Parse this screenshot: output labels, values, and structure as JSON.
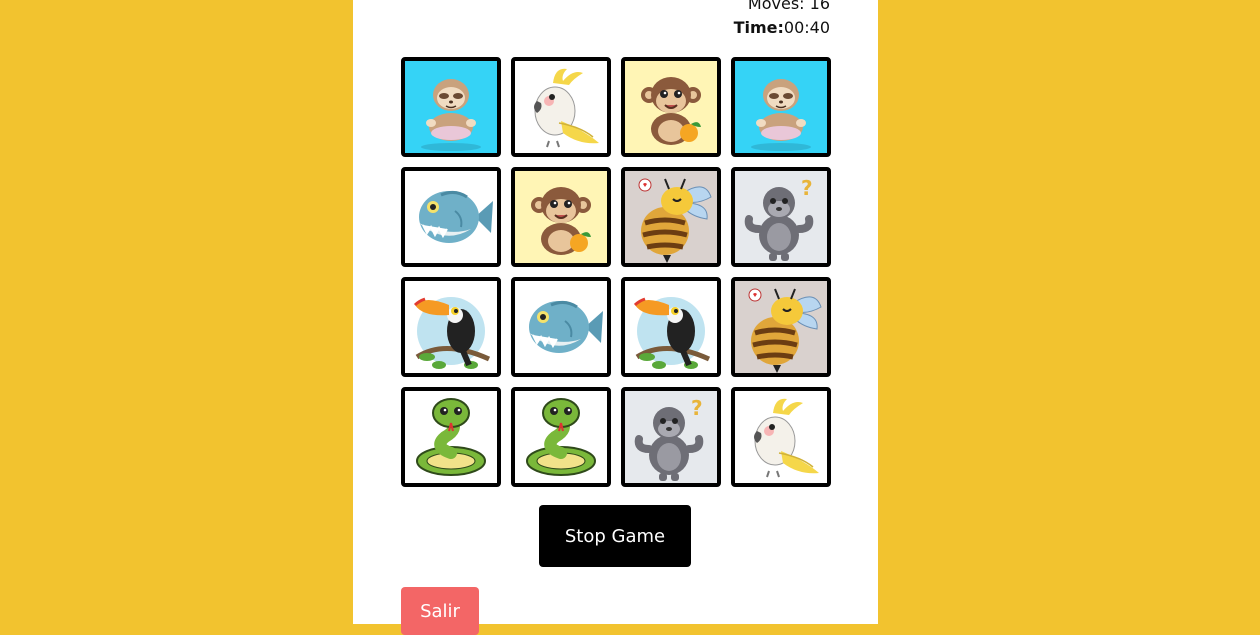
{
  "stats": {
    "moves_label": "Moves:",
    "moves_value": "16",
    "time_label": "Time:",
    "time_value": "00:40"
  },
  "cards": [
    {
      "animal": "sloth",
      "bg": "#35D3F6",
      "state": "face-up"
    },
    {
      "animal": "cockatoo",
      "bg": "#FFFFFF",
      "state": "face-up"
    },
    {
      "animal": "monkey",
      "bg": "#FFF5B5",
      "state": "face-up"
    },
    {
      "animal": "sloth",
      "bg": "#35D3F6",
      "state": "face-up"
    },
    {
      "animal": "piranha",
      "bg": "#FFFFFF",
      "state": "face-up"
    },
    {
      "animal": "monkey",
      "bg": "#FFF5B5",
      "state": "face-up"
    },
    {
      "animal": "bee",
      "bg": "#D9D1CE",
      "state": "face-up"
    },
    {
      "animal": "gorilla",
      "bg": "#E6E9ED",
      "state": "face-up"
    },
    {
      "animal": "toucan",
      "bg": "#FFFFFF",
      "state": "face-up"
    },
    {
      "animal": "piranha",
      "bg": "#FFFFFF",
      "state": "face-up"
    },
    {
      "animal": "toucan",
      "bg": "#FFFFFF",
      "state": "face-up"
    },
    {
      "animal": "bee",
      "bg": "#D9D1CE",
      "state": "face-up"
    },
    {
      "animal": "snake",
      "bg": "#FFFFFF",
      "state": "face-up"
    },
    {
      "animal": "snake",
      "bg": "#FFFFFF",
      "state": "face-up"
    },
    {
      "animal": "gorilla",
      "bg": "#E6E9ED",
      "state": "face-up"
    },
    {
      "animal": "cockatoo",
      "bg": "#FFFFFF",
      "state": "face-up"
    }
  ],
  "controls": {
    "stop_label": "Stop Game",
    "exit_label": "Salir"
  },
  "colors": {
    "page_bg": "#F2C32F",
    "panel_bg": "#FFFFFF",
    "stop_bg": "#000000",
    "exit_bg": "#F36666"
  }
}
